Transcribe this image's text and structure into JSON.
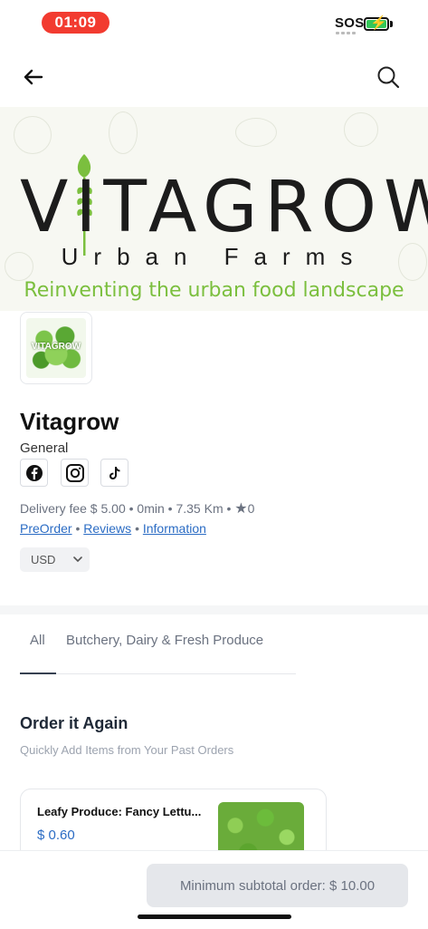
{
  "status_bar": {
    "time": "01:09",
    "sos": "SOS"
  },
  "banner": {
    "brand": "VITAGROW",
    "subtitle": "Urban Farms",
    "tagline": "Reinventing the urban food landscape",
    "logo_box_text": "VITAGROW",
    "tagline_color": "#7bbf3e"
  },
  "store": {
    "name": "Vitagrow",
    "category": "General",
    "social_icons": [
      "facebook-icon",
      "instagram-icon",
      "tiktok-icon"
    ],
    "delivery_fee": "Delivery fee $ 5.00",
    "delivery_time": "0min",
    "distance": "7.35 Km",
    "rating": "0",
    "links": {
      "preorder": "PreOrder",
      "reviews": "Reviews",
      "information": "Information"
    },
    "currency": "USD"
  },
  "tabs": [
    {
      "label": "All",
      "active": true
    },
    {
      "label": "Butchery, Dairy & Fresh Produce",
      "active": false
    }
  ],
  "order_again": {
    "title": "Order it Again",
    "subtitle": "Quickly Add Items from Your Past Orders",
    "items": [
      {
        "name": "Leafy Produce: Fancy Lettu...",
        "price": "$ 0.60"
      }
    ]
  },
  "footer": {
    "min_order": "Minimum subtotal order: $ 10.00"
  },
  "colors": {
    "accent": "#2b6cc4",
    "status_pill": "#f23b30",
    "battery": "#34c759"
  }
}
